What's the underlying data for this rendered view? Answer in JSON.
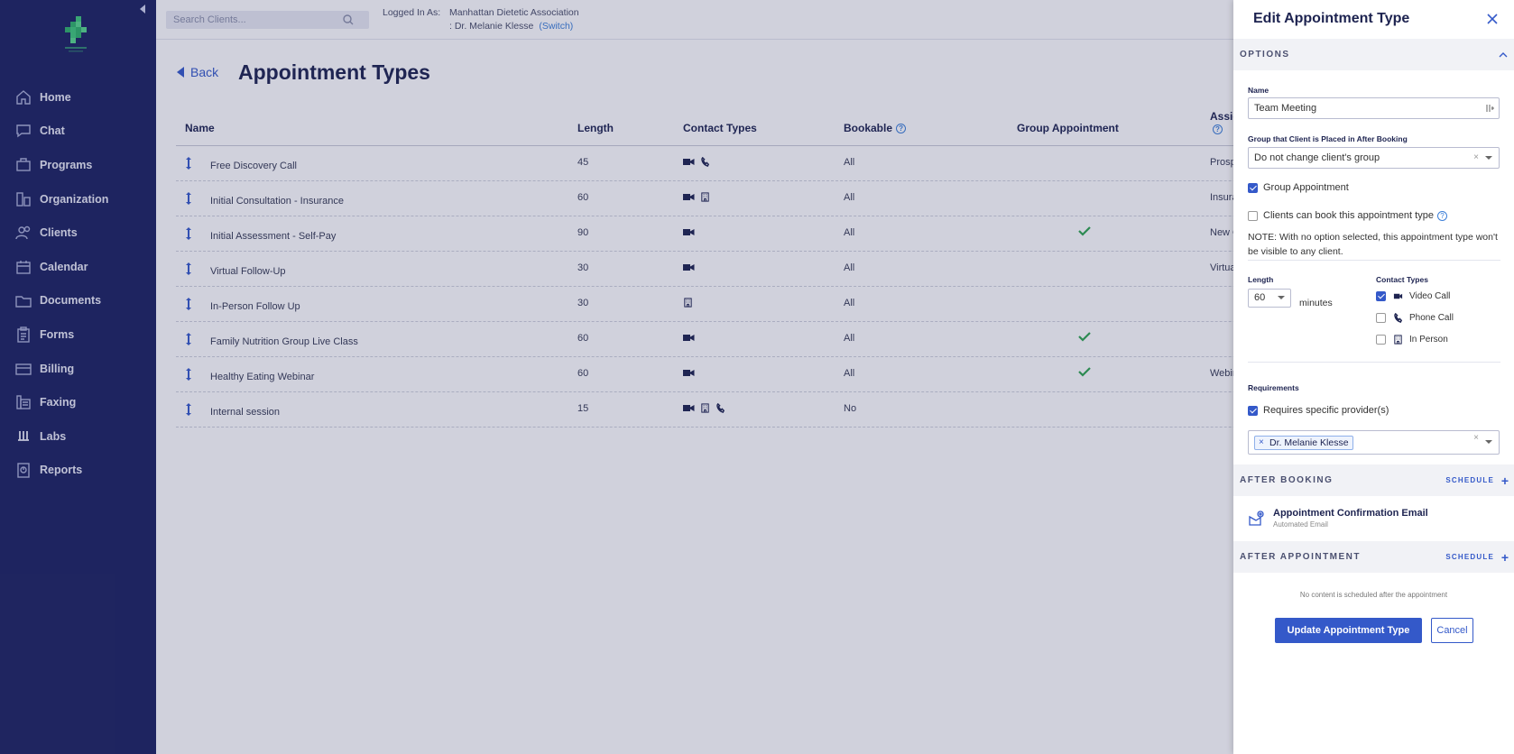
{
  "sidebar": {
    "items": [
      {
        "label": "Home",
        "icon": "home-icon"
      },
      {
        "label": "Chat",
        "icon": "chat-icon"
      },
      {
        "label": "Programs",
        "icon": "programs-icon"
      },
      {
        "label": "Organization",
        "icon": "organization-icon"
      },
      {
        "label": "Clients",
        "icon": "clients-icon"
      },
      {
        "label": "Calendar",
        "icon": "calendar-icon"
      },
      {
        "label": "Documents",
        "icon": "documents-icon"
      },
      {
        "label": "Forms",
        "icon": "forms-icon"
      },
      {
        "label": "Billing",
        "icon": "billing-icon"
      },
      {
        "label": "Faxing",
        "icon": "faxing-icon"
      },
      {
        "label": "Labs",
        "icon": "labs-icon"
      },
      {
        "label": "Reports",
        "icon": "reports-icon"
      }
    ]
  },
  "topbar": {
    "search_placeholder": "Search Clients...",
    "logged_in_label": "Logged In As:",
    "org_name": "Manhattan Dietetic Association",
    "user_name": ": Dr. Melanie Klesse",
    "switch_label": "(Switch)"
  },
  "page": {
    "back_label": "Back",
    "title": "Appointment Types"
  },
  "table": {
    "headers": {
      "name": "Name",
      "length": "Length",
      "contact": "Contact Types",
      "bookable": "Bookable",
      "group": "Group Appointment",
      "assign": "Assigne"
    },
    "rows": [
      {
        "name": "Free Discovery Call",
        "length": "45",
        "contact": [
          "video",
          "phone"
        ],
        "bookable": "All",
        "group": false,
        "assign": "Prospec"
      },
      {
        "name": "Initial Consultation - Insurance",
        "length": "60",
        "contact": [
          "video",
          "building"
        ],
        "bookable": "All",
        "group": false,
        "assign": "Insuranc"
      },
      {
        "name": "Initial Assessment - Self-Pay",
        "length": "90",
        "contact": [
          "video"
        ],
        "bookable": "All",
        "group": true,
        "assign": "New Cli"
      },
      {
        "name": "Virtual Follow-Up",
        "length": "30",
        "contact": [
          "video"
        ],
        "bookable": "All",
        "group": false,
        "assign": "Virtual C"
      },
      {
        "name": "In-Person Follow Up",
        "length": "30",
        "contact": [
          "building"
        ],
        "bookable": "All",
        "group": false,
        "assign": ""
      },
      {
        "name": "Family Nutrition Group Live Class",
        "length": "60",
        "contact": [
          "video"
        ],
        "bookable": "All",
        "group": true,
        "assign": ""
      },
      {
        "name": "Healthy Eating Webinar",
        "length": "60",
        "contact": [
          "video"
        ],
        "bookable": "All",
        "group": true,
        "assign": "Webinar"
      },
      {
        "name": "Internal session",
        "length": "15",
        "contact": [
          "video",
          "building",
          "phone"
        ],
        "bookable": "No",
        "group": false,
        "assign": ""
      }
    ]
  },
  "drawer": {
    "title": "Edit Appointment Type",
    "options_label": "OPTIONS",
    "name_label": "Name",
    "name_value": "Team Meeting",
    "group_label": "Group that Client is Placed in After Booking",
    "group_value": "Do not change client's group",
    "group_appt_label": "Group Appointment",
    "group_appt_checked": true,
    "bookable_label": "Clients can book this appointment type",
    "bookable_checked": false,
    "note": "NOTE: With no option selected, this appointment type won't be visible to any client.",
    "length_label": "Length",
    "length_value": "60",
    "minutes_label": "minutes",
    "contact_types_label": "Contact Types",
    "contact_types": [
      {
        "label": "Video Call",
        "checked": true,
        "icon": "video-icon"
      },
      {
        "label": "Phone Call",
        "checked": false,
        "icon": "phone-icon"
      },
      {
        "label": "In Person",
        "checked": false,
        "icon": "building-icon"
      }
    ],
    "requirements_label": "Requirements",
    "requires_provider_label": "Requires specific provider(s)",
    "requires_provider_checked": true,
    "provider_tag": "Dr. Melanie Klesse",
    "after_booking_label": "AFTER BOOKING",
    "schedule_label": "SCHEDULE",
    "email_title": "Appointment Confirmation Email",
    "email_sub": "Automated Email",
    "after_appt_label": "AFTER APPOINTMENT",
    "empty_msg": "No content is scheduled after the appointment",
    "update_label": "Update Appointment Type",
    "cancel_label": "Cancel"
  },
  "colors": {
    "sidebar_bg": "#1c2260",
    "accent": "#3459c9",
    "check_green": "#2ea44f"
  }
}
